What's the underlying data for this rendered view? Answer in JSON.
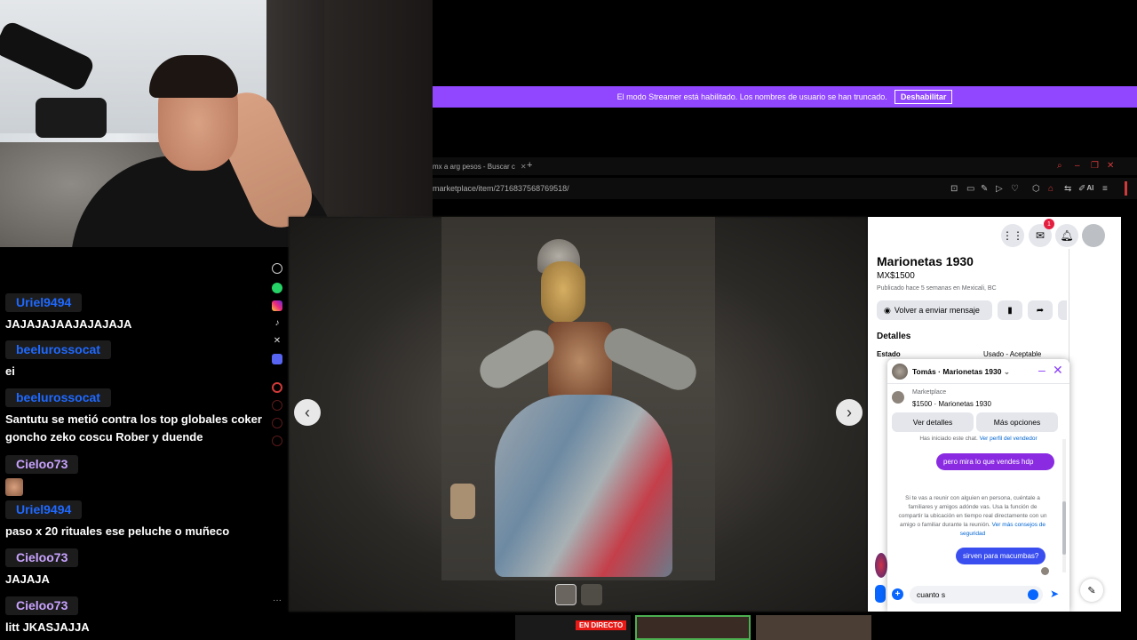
{
  "streamer_banner": {
    "message": "El modo Streamer está habilitado. Los nombres de usuario se han truncado.",
    "button_label": "Deshabilitar"
  },
  "browser": {
    "tab_title": "mx a arg pesos - Buscar c",
    "address": "marketplace/item/2716837568769518/",
    "ai_label": "AI"
  },
  "chat": {
    "messages": [
      {
        "user": "Uriel9494",
        "text": "JAJAJAJAAJAJAJAJA",
        "color": "#1f69ff"
      },
      {
        "user": "beelurossocat",
        "text": "ei",
        "color": "#1f69ff"
      },
      {
        "user": "beelurossocat",
        "text": "Santutu se metió contra los top globales coker goncho zeko coscu Rober y duende",
        "color": "#1f69ff"
      },
      {
        "user": "Cieloo73",
        "text": "",
        "color": "#c9a3ff"
      },
      {
        "user": "Uriel9494",
        "text": "paso x 20 rituales ese peluche o muñeco",
        "color": "#1f69ff"
      },
      {
        "user": "Cieloo73",
        "text": "JAJAJA",
        "color": "#c9a3ff"
      },
      {
        "user": "Cieloo73",
        "text": "litt JKASJAJJA",
        "color": "#c9a3ff"
      }
    ]
  },
  "marketplace": {
    "title": "Marionetas 1930",
    "price": "MX$1500",
    "published": "Publicado hace 5 semanas en Mexicali, BC",
    "message_button": "Volver a enviar mensaje",
    "details_heading": "Detalles",
    "estado_label": "Estado",
    "estado_value": "Usado - Aceptable",
    "messenger_badge": "1"
  },
  "messenger": {
    "title": "Tomás · Marionetas 1930",
    "marketplace_label": "Marketplace",
    "listing": "$1500 · Marionetas 1930",
    "details_button": "Ver detalles",
    "more_button": "Más opciones",
    "started_text": "Has iniciado este chat.",
    "seller_link": "Ver perfil del vendedor",
    "bubble1": "pero mira lo que vendes hdp",
    "warning": "Si te vas a reunir con alguien en persona, cuéntale a familiares y amigos adónde vas. Usa la función de compartir la ubicación en tiempo real directamente con un amigo o familiar durante la reunión.",
    "warning_link": "Ver más consejos de seguridad",
    "bubble2": "sirven para macumbas?",
    "input_value": "cuanto s"
  },
  "bottom": {
    "live_label": "EN DIRECTO"
  },
  "icons": {
    "prev": "chevron-left-icon",
    "next": "chevron-right-icon",
    "close": "close-icon"
  }
}
